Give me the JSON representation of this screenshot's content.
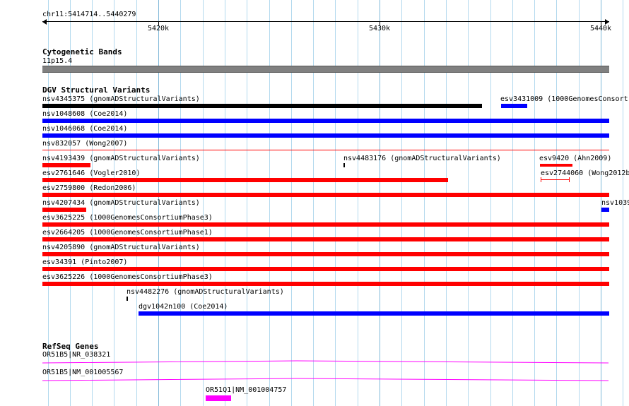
{
  "region": "chr11:5414714..5440279",
  "ruler": {
    "ticks": [
      "5420k",
      "5430k",
      "5440k"
    ]
  },
  "cytobands": {
    "title": "Cytogenetic Bands",
    "band": "11p15.4"
  },
  "dgv": {
    "title": "DGV Structural Variants",
    "colors": {
      "loss": "#ff0000",
      "gain": "#0000ff",
      "complex": "#000000"
    },
    "variants": [
      "nsv4345375 (gnomADStructuralVariants)",
      "esv3431009 (1000GenomesConsort",
      "nsv1048608 (Coe2014)",
      "nsv1046068 (Coe2014)",
      "nsv832057 (Wong2007)",
      "nsv4193439 (gnomADStructuralVariants)",
      "nsv4483176 (gnomADStructuralVariants)",
      "esv9420 (Ahn2009)",
      "esv2761646 (Vogler2010)",
      "esv2744060 (Wong2012b",
      "esv2759800 (Redon2006)",
      "nsv4207434 (gnomADStructuralVariants)",
      "nsv1039",
      "esv3625225 (1000GenomesConsortiumPhase3)",
      "esv2664205 (1000GenomesConsortiumPhase1)",
      "nsv4205890 (gnomADStructuralVariants)",
      "esv34391 (Pinto2007)",
      "esv3625226 (1000GenomesConsortiumPhase3)",
      "nsv4482276 (gnomADStructuralVariants)",
      "dgv1042n100 (Coe2014)"
    ]
  },
  "refseq": {
    "title": "RefSeq Genes",
    "color": "#ff00ff",
    "genes": [
      "OR51B5|NR_038321",
      "OR51B5|NM_001005567",
      "OR51Q1|NM_001004757"
    ]
  }
}
